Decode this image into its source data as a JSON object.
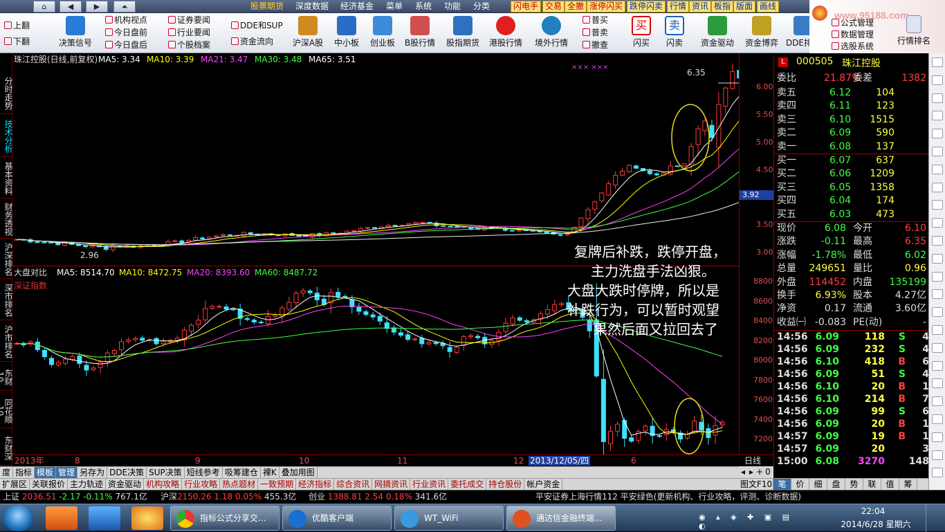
{
  "menu": {
    "nav": [
      "⌂",
      "◀",
      "▶",
      "⏶"
    ],
    "items": [
      "股票期货",
      "深度数据",
      "经济基金",
      "菜单",
      "系统",
      "功能",
      "分类"
    ],
    "tabs_red": [
      "闪电手",
      "交易",
      "全撤",
      "涨停闪买",
      "跌停闪卖",
      "行情",
      "资讯",
      "板指",
      "版面",
      "画线"
    ]
  },
  "toolbar": {
    "up": "上翻",
    "down": "下翻",
    "decision": "决策信号",
    "small_a": [
      "机构视点",
      "今日盘前",
      "今日盘后"
    ],
    "small_b": [
      "证券要闻",
      "行业要闻",
      "个股档案"
    ],
    "small_c": [
      "DDE和SUP",
      "资金流向"
    ],
    "big": [
      "沪深A股",
      "中小板",
      "创业板",
      "B股行情",
      "股指期货",
      "港股行情",
      "境外行情"
    ],
    "small_d": [
      "普买",
      "普卖",
      "撤查"
    ],
    "big2": [
      "闪买",
      "闪卖",
      "资金驱动",
      "资金博弈",
      "DDE排名"
    ],
    "small_e": [
      "公式管理",
      "数据管理",
      "选股系统"
    ],
    "last": "行情排名"
  },
  "logo": {
    "text": "www.95188.com"
  },
  "left_tabs": [
    "分时走势",
    "技术分析",
    "基本资料",
    "财务透视",
    "沪深排名",
    "深市排名",
    "沪市排名",
    "东财10",
    "同花顺10",
    "东财深"
  ],
  "top_chart": {
    "title": "珠江控股(日线,前复权)",
    "ma": [
      {
        "label": "MA5: 3.34",
        "color": "#ffffff"
      },
      {
        "label": "MA10: 3.39",
        "color": "#ffff00"
      },
      {
        "label": "MA21: 3.47",
        "color": "#ff40ff"
      },
      {
        "label": "MA30: 3.48",
        "color": "#40ff40"
      },
      {
        "label": "MA65: 3.51",
        "color": "#ffffff"
      }
    ],
    "ticks": [
      "6.00",
      "5.50",
      "5.00",
      "4.50",
      "4.00",
      "3.50",
      "3.00"
    ],
    "high_label": "6.35",
    "low_label": "2.96",
    "price_tag": "3.92",
    "marker": "××× ×××"
  },
  "bottom_chart": {
    "title": "大盘对比",
    "sub": "深证指数",
    "ma": [
      {
        "label": "MA5: 8514.70",
        "color": "#ffffff"
      },
      {
        "label": "MA10: 8472.75",
        "color": "#ffff00"
      },
      {
        "label": "MA20: 8393.60",
        "color": "#ff40ff"
      },
      {
        "label": "MA60: 8487.72",
        "color": "#40ff40"
      }
    ],
    "ticks": [
      "8800",
      "8600",
      "8400",
      "8200",
      "8000",
      "7800",
      "7600",
      "7400",
      "7200"
    ]
  },
  "annotation": [
    "复牌后补跌，跌停开盘，",
    "主力洗盘手法凶狠。",
    "大盘大跌时停牌，所以是",
    "补跌行为，可以暂时观望",
    "果然后面又拉回去了"
  ],
  "xaxis": {
    "labels": [
      "2013年",
      "8",
      "9",
      "10",
      "11",
      "12",
      "2013/12/05/四",
      "6"
    ],
    "right": "日线"
  },
  "quote": {
    "code": "000505",
    "name": "珠江控股",
    "badge": "L",
    "weibi_label": "委比",
    "weibi": "21.87%",
    "weicha_label": "委差",
    "weicha": "1382",
    "sell": [
      {
        "l": "卖五",
        "p": "6.12",
        "v": "104"
      },
      {
        "l": "卖四",
        "p": "6.11",
        "v": "123"
      },
      {
        "l": "卖三",
        "p": "6.10",
        "v": "1515"
      },
      {
        "l": "卖二",
        "p": "6.09",
        "v": "590"
      },
      {
        "l": "卖一",
        "p": "6.08",
        "v": "137"
      }
    ],
    "buy": [
      {
        "l": "买一",
        "p": "6.07",
        "v": "637"
      },
      {
        "l": "买二",
        "p": "6.06",
        "v": "1209"
      },
      {
        "l": "买三",
        "p": "6.05",
        "v": "1358"
      },
      {
        "l": "买四",
        "p": "6.04",
        "v": "174"
      },
      {
        "l": "买五",
        "p": "6.03",
        "v": "473"
      }
    ],
    "stats": [
      {
        "a": "现价",
        "av": "6.08",
        "b": "今开",
        "bv": "6.10"
      },
      {
        "a": "涨跌",
        "av": "-0.11",
        "b": "最高",
        "bv": "6.35"
      },
      {
        "a": "涨幅",
        "av": "-1.78%",
        "b": "最低",
        "bv": "6.02"
      },
      {
        "a": "总量",
        "av": "249651",
        "b": "量比",
        "bv": "0.96"
      },
      {
        "a": "外盘",
        "av": "114452",
        "b": "内盘",
        "bv": "135199"
      },
      {
        "a": "换手",
        "av": "6.93%",
        "b": "股本",
        "bv": "4.27亿"
      },
      {
        "a": "净资",
        "av": "0.17",
        "b": "流通",
        "bv": "3.60亿"
      },
      {
        "a": "收益㈠",
        "av": "-0.083",
        "b": "PE(动)",
        "bv": "-"
      }
    ],
    "trades": [
      {
        "t": "14:56",
        "p": "6.09",
        "v": "118",
        "s": "S",
        "n": "4"
      },
      {
        "t": "14:56",
        "p": "6.09",
        "v": "232",
        "s": "S",
        "n": "4"
      },
      {
        "t": "14:56",
        "p": "6.10",
        "v": "418",
        "s": "B",
        "n": "6"
      },
      {
        "t": "14:56",
        "p": "6.09",
        "v": "51",
        "s": "S",
        "n": "4"
      },
      {
        "t": "14:56",
        "p": "6.10",
        "v": "20",
        "s": "B",
        "n": "1"
      },
      {
        "t": "14:56",
        "p": "6.10",
        "v": "214",
        "s": "B",
        "n": "7"
      },
      {
        "t": "14:56",
        "p": "6.09",
        "v": "99",
        "s": "S",
        "n": "6"
      },
      {
        "t": "14:56",
        "p": "6.09",
        "v": "20",
        "s": "B",
        "n": "1"
      },
      {
        "t": "14:57",
        "p": "6.09",
        "v": "19",
        "s": "B",
        "n": "1"
      },
      {
        "t": "14:57",
        "p": "6.09",
        "v": "20",
        "s": "",
        "n": "3"
      },
      {
        "t": "15:00",
        "p": "6.08",
        "v": "3270",
        "s": "",
        "n": "148"
      }
    ]
  },
  "row1": [
    "度",
    "指标",
    "模板",
    "管理",
    "另存为",
    "DDE决策",
    "SUP决策",
    "短线参考",
    "吸筹建仓",
    "裸K",
    "叠加用图"
  ],
  "row1_right": [
    "◂",
    "▸",
    "+",
    "0"
  ],
  "row2": [
    "扩展区",
    "关联报价",
    "主力轨迹",
    "资金驱动",
    "机构攻略",
    "行业攻略",
    "热点题材",
    "一致预期",
    "经济指标",
    "综合资讯",
    "网摘资讯",
    "行业资讯",
    "委托成交",
    "持仓股份",
    "帐户资金"
  ],
  "row2_right": [
    "图文F10",
    "笔",
    "价",
    "细",
    "盘",
    "势",
    "联",
    "值",
    "筹"
  ],
  "status": {
    "sh": "上证",
    "sh_v": "2036.51",
    "sh_c": "-2.17",
    "sh_p": "-0.11%",
    "sh_a": "767.1亿",
    "hs": "沪深",
    "hs_v": "2150.26",
    "hs_c": "1.18",
    "hs_p": "0.05%",
    "hs_a": "455.3亿",
    "cy": "创业",
    "cy_v": "1388.81",
    "cy_c": "2.54",
    "cy_p": "0.18%",
    "cy_a": "341.6亿",
    "msg": "平安证券上海行情112 平安绿色(更新机构、行业攻略，评测、诊断数据)"
  },
  "taskbar": {
    "tasks": [
      "指标公式分享交...",
      "优酷客户端",
      "WT_WiFi",
      "通达信金融终端..."
    ],
    "time": "22:04",
    "date": "2014/6/28 星期六"
  }
}
